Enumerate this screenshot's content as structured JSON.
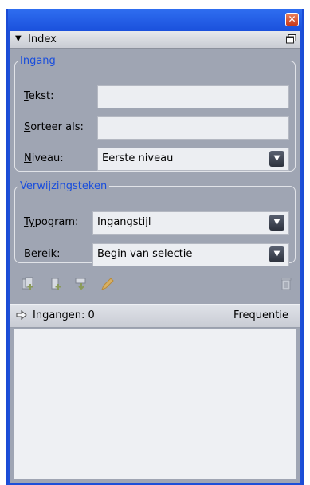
{
  "window": {
    "close_glyph": "✕"
  },
  "panel": {
    "title": "Index",
    "collapse_icon": "triangle-down-icon",
    "menu_icon": "panel-menu-icon"
  },
  "ingang": {
    "legend": "Ingang",
    "tekst_label_u": "T",
    "tekst_label_rest": "ekst:",
    "tekst_value": "",
    "sorteer_label_u": "S",
    "sorteer_label_rest": "orteer als:",
    "sorteer_value": "",
    "niveau_label_u": "N",
    "niveau_label_rest": "iveau:",
    "niveau_value": "Eerste niveau"
  },
  "verwijzing": {
    "legend": "Verwijzingsteken",
    "typogram_label_u": "Ty",
    "typogram_label_rest": "pogram:",
    "typogram_value": "Ingangstijl",
    "bereik_label_u": "B",
    "bereik_label_rest": "ereik:",
    "bereik_value": "Begin van selectie"
  },
  "toolbar": {
    "icons": [
      "add-entry-icon",
      "add-reference-icon",
      "replace-icon",
      "edit-pencil-icon",
      "trash-icon"
    ]
  },
  "list": {
    "count_label": "Ingangen: 0",
    "freq_label": "Frequentie"
  }
}
